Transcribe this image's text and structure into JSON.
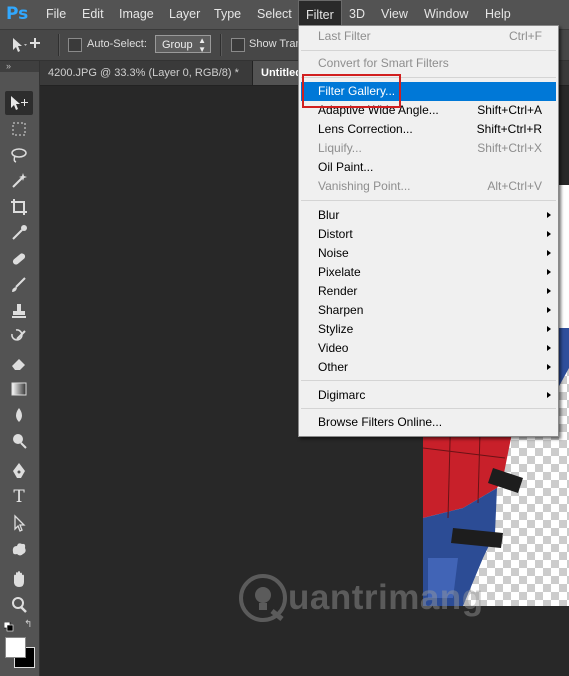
{
  "app": {
    "logo": "Ps"
  },
  "menubar": {
    "items": [
      "File",
      "Edit",
      "Image",
      "Layer",
      "Type",
      "Select",
      "Filter",
      "3D",
      "View",
      "Window",
      "Help"
    ],
    "active": "Filter"
  },
  "options": {
    "auto_select_label": "Auto-Select:",
    "group_value": "Group",
    "show_transform_label": "Show Trans"
  },
  "toolbox": {
    "collapse_glyph": "»"
  },
  "doc_tabs": [
    {
      "label": "4200.JPG @ 33.3% (Layer 0, RGB/8) *"
    },
    {
      "label": "Untitled"
    }
  ],
  "filter_menu": {
    "items": [
      {
        "label": "Last Filter",
        "shortcut": "Ctrl+F",
        "disabled": true
      },
      {
        "label": "Convert for Smart Filters",
        "shortcut": "",
        "disabled": true
      },
      {
        "label": "Filter Gallery...",
        "shortcut": "",
        "highlighted": true
      },
      {
        "label": "Adaptive Wide Angle...",
        "shortcut": "Shift+Ctrl+A"
      },
      {
        "label": "Lens Correction...",
        "shortcut": "Shift+Ctrl+R"
      },
      {
        "label": "Liquify...",
        "shortcut": "Shift+Ctrl+X",
        "disabled": true
      },
      {
        "label": "Oil Paint...",
        "shortcut": ""
      },
      {
        "label": "Vanishing Point...",
        "shortcut": "Alt+Ctrl+V",
        "disabled": true
      },
      {
        "label": "Blur",
        "submenu": true
      },
      {
        "label": "Distort",
        "submenu": true
      },
      {
        "label": "Noise",
        "submenu": true
      },
      {
        "label": "Pixelate",
        "submenu": true
      },
      {
        "label": "Render",
        "submenu": true
      },
      {
        "label": "Sharpen",
        "submenu": true
      },
      {
        "label": "Stylize",
        "submenu": true
      },
      {
        "label": "Video",
        "submenu": true
      },
      {
        "label": "Other",
        "submenu": true
      },
      {
        "label": "Digimarc",
        "submenu": true
      },
      {
        "label": "Browse Filters Online..."
      }
    ]
  },
  "watermark": {
    "text": "uantrimang"
  },
  "colors": {
    "highlight": "#0078d7",
    "annotation": "#d11f1f",
    "ps_blue": "#31a8ff"
  }
}
